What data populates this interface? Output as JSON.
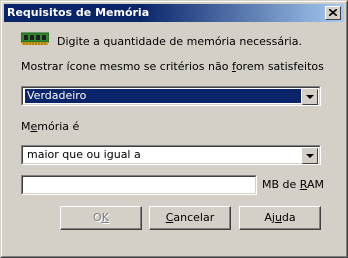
{
  "window": {
    "title": "Requisitos de Memória"
  },
  "intro": {
    "text": "Digite a quantidade de memória necessária."
  },
  "show_icon": {
    "label_pre": "Mostrar ícone mesmo se critérios não ",
    "label_mnemonic": "f",
    "label_post": "orem satisfeitos",
    "value": "Verdadeiro"
  },
  "memory": {
    "label_pre": "M",
    "label_mnemonic": "e",
    "label_post": "mória é",
    "comparison_value": "maior que ou igual a",
    "amount_value": "",
    "unit_pre": "MB de ",
    "unit_mnemonic": "R",
    "unit_post": "AM"
  },
  "buttons": {
    "ok": {
      "pre": "O",
      "mnemonic": "K",
      "post": ""
    },
    "cancel": {
      "pre": "",
      "mnemonic": "C",
      "post": "ancelar"
    },
    "help": {
      "pre": "Aj",
      "mnemonic": "u",
      "post": "da"
    }
  },
  "colors": {
    "title_bar": "#0a246a",
    "dialog_bg": "#d4d0c8",
    "selection": "#0a246a"
  },
  "icons": {
    "memory": "ram-chip-icon",
    "close": "close-icon",
    "dropdown": "chevron-down-icon"
  }
}
